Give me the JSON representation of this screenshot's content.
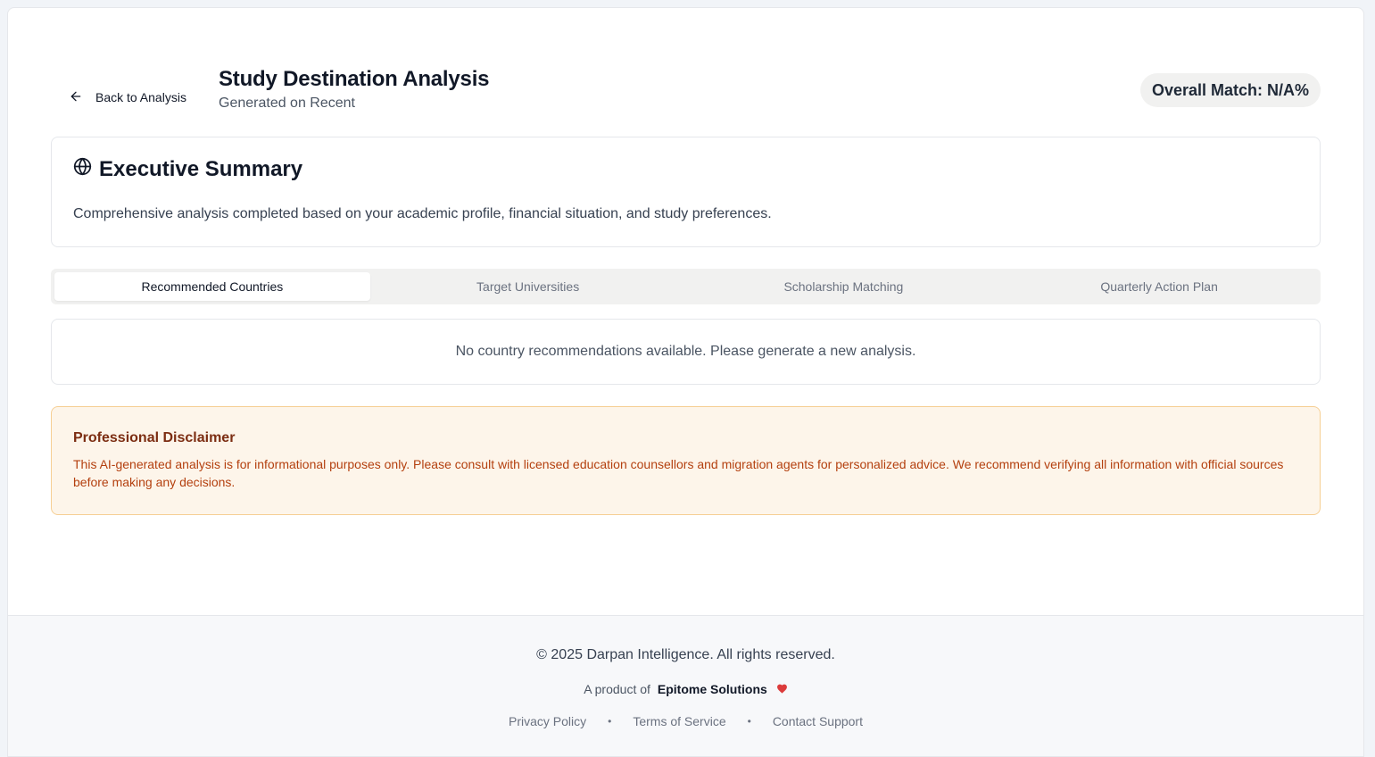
{
  "header": {
    "back_label": "Back to Analysis",
    "title": "Study Destination Analysis",
    "subtitle": "Generated on Recent",
    "overall_match": "Overall Match: N/A%"
  },
  "summary": {
    "heading": "Executive Summary",
    "text": "Comprehensive analysis completed based on your academic profile, financial situation, and study preferences."
  },
  "tabs": [
    {
      "label": "Recommended Countries",
      "active": true
    },
    {
      "label": "Target Universities",
      "active": false
    },
    {
      "label": "Scholarship Matching",
      "active": false
    },
    {
      "label": "Quarterly Action Plan",
      "active": false
    }
  ],
  "empty_state": "No country recommendations available. Please generate a new analysis.",
  "disclaimer": {
    "title": "Professional Disclaimer",
    "text": "This AI-generated analysis is for informational purposes only. Please consult with licensed education counsellors and migration agents for personalized advice. We recommend verifying all information with official sources before making any decisions."
  },
  "footer": {
    "copyright": "© 2025 Darpan Intelligence. All rights reserved.",
    "product_prefix": "A product of",
    "product_brand": "Epitome Solutions",
    "links": [
      "Privacy Policy",
      "Terms of Service",
      "Contact Support"
    ],
    "separator": "•"
  },
  "icons": {
    "back": "arrow-left-icon",
    "summary": "globe-icon",
    "heart": "heart-icon"
  },
  "colors": {
    "disclaimer_bg": "#fdf5ea",
    "disclaimer_border": "#f6cf94",
    "disclaimer_title": "#7c2d12",
    "disclaimer_text": "#b4400f",
    "heart": "#dc3b3b"
  }
}
